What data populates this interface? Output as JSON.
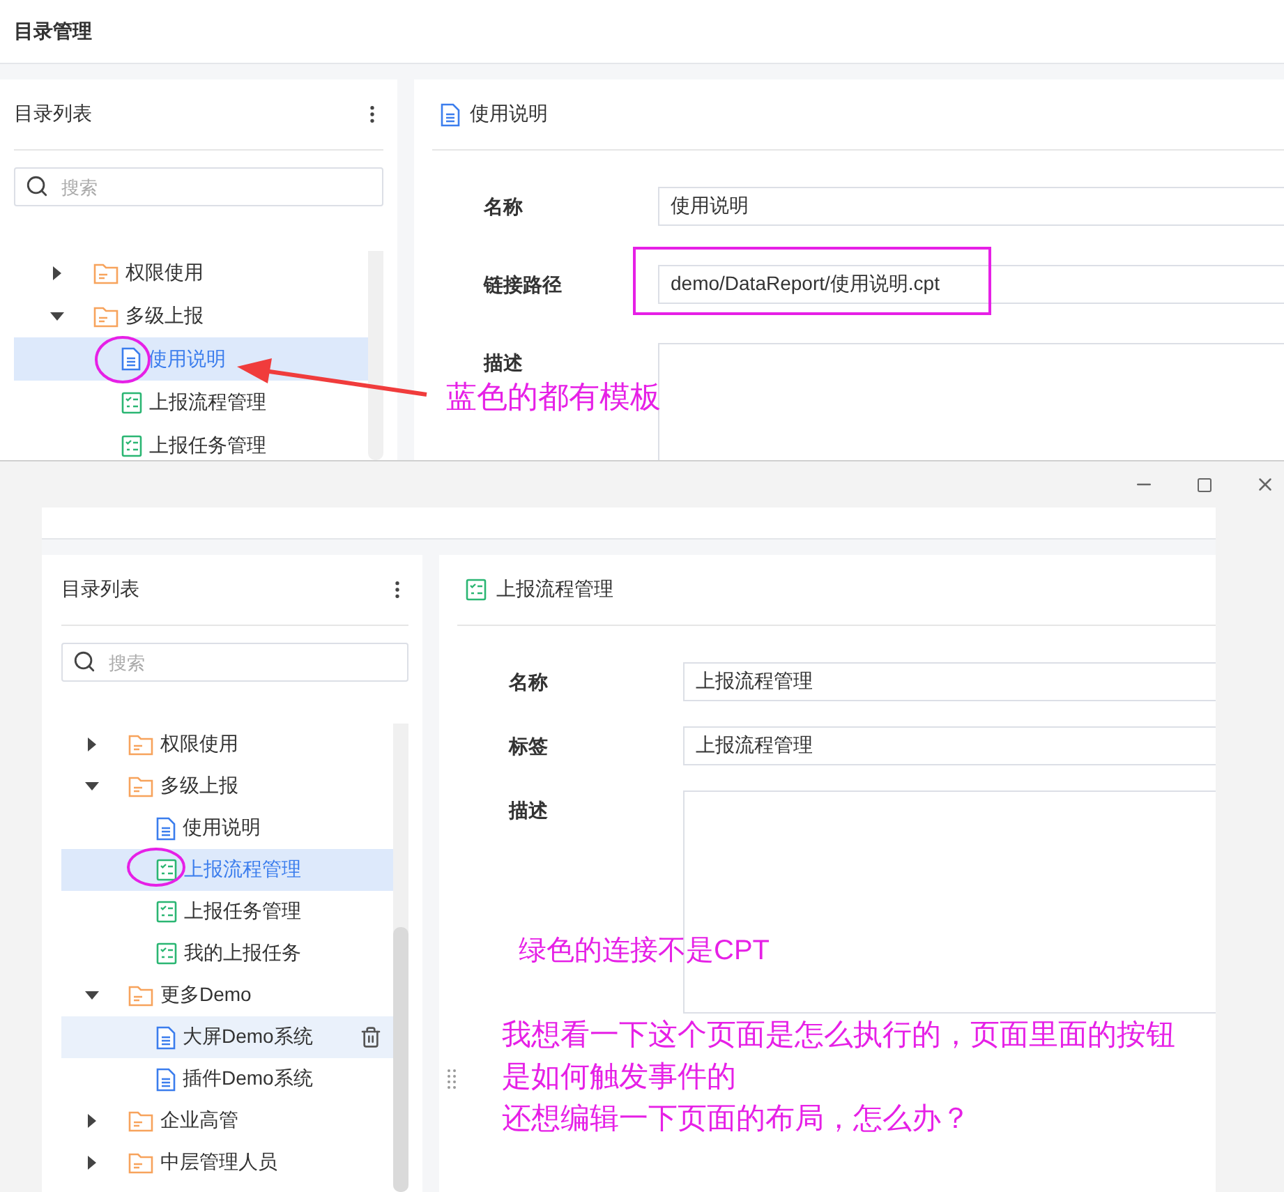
{
  "screens": [
    {
      "kind": "page",
      "header_title": "目录管理",
      "sidebar": {
        "title": "目录列表",
        "search_placeholder": "搜索",
        "tree": [
          {
            "label": "权限使用",
            "kind": "folder",
            "expanded": false,
            "selected": false,
            "hovered": false
          },
          {
            "label": "多级上报",
            "kind": "folder",
            "expanded": true,
            "selected": false,
            "hovered": false,
            "children": [
              {
                "label": "使用说明",
                "kind": "template",
                "selected": true,
                "hovered": false
              },
              {
                "label": "上报流程管理",
                "kind": "link",
                "selected": false,
                "hovered": false
              },
              {
                "label": "上报任务管理",
                "kind": "link",
                "selected": false,
                "hovered": false
              }
            ]
          }
        ]
      },
      "detail": {
        "title": "使用说明",
        "kind": "template",
        "fields": [
          {
            "label": "名称",
            "kind": "input",
            "value": "使用说明"
          },
          {
            "label": "链接路径",
            "kind": "input",
            "value": "demo/DataReport/使用说明.cpt"
          },
          {
            "label": "描述",
            "kind": "textarea"
          }
        ]
      }
    },
    {
      "kind": "window",
      "sidebar": {
        "title": "目录列表",
        "search_placeholder": "搜索",
        "tree": [
          {
            "label": "权限使用",
            "kind": "folder",
            "expanded": false,
            "selected": false,
            "hovered": false
          },
          {
            "label": "多级上报",
            "kind": "folder",
            "expanded": true,
            "selected": false,
            "hovered": false,
            "children": [
              {
                "label": "使用说明",
                "kind": "template",
                "selected": false,
                "hovered": false
              },
              {
                "label": "上报流程管理",
                "kind": "link",
                "selected": true,
                "hovered": false
              },
              {
                "label": "上报任务管理",
                "kind": "link",
                "selected": false,
                "hovered": false
              },
              {
                "label": "我的上报任务",
                "kind": "link",
                "selected": false,
                "hovered": false
              }
            ]
          },
          {
            "label": "更多Demo",
            "kind": "folder",
            "expanded": true,
            "selected": false,
            "hovered": false,
            "children": [
              {
                "label": "大屏Demo系统",
                "kind": "template",
                "selected": false,
                "hovered": true
              },
              {
                "label": "插件Demo系统",
                "kind": "template",
                "selected": false,
                "hovered": false
              }
            ]
          },
          {
            "label": "企业高管",
            "kind": "folder",
            "expanded": false,
            "selected": false,
            "hovered": false
          },
          {
            "label": "中层管理人员",
            "kind": "folder",
            "expanded": false,
            "selected": false,
            "hovered": false
          }
        ]
      },
      "detail": {
        "title": "上报流程管理",
        "kind": "link",
        "fields": [
          {
            "label": "名称",
            "kind": "input",
            "value": "上报流程管理"
          },
          {
            "label": "标签",
            "kind": "input",
            "value": "上报流程管理"
          },
          {
            "label": "描述",
            "kind": "textarea"
          }
        ]
      }
    }
  ],
  "annotations": [
    {
      "text": "蓝色的都有模板"
    },
    {
      "text": "绿色的连接不是CPT"
    },
    {
      "text": "我想看一下这个页面是怎么执行的，页面里面的按钮是如何触发事件的"
    },
    {
      "text": "还想编辑一下页面的布局，怎么办？"
    }
  ]
}
